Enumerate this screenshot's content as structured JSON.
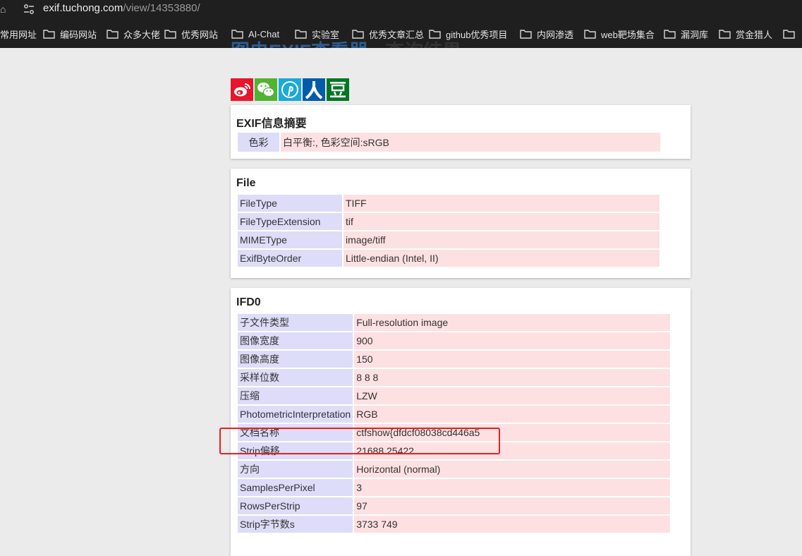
{
  "browser": {
    "url_host": "exif.tuchong.com",
    "url_path": "/view/14353880/",
    "bookmarks": [
      "常用网址",
      "编码网站",
      "众多大佬",
      "优秀网站",
      "AI-Chat",
      "实验室",
      "优秀文章汇总",
      "github优秀项目",
      "内网渗透",
      "web靶场集合",
      "漏洞库",
      "赏金猎人"
    ]
  },
  "page": {
    "title_part1": "图虫EXIF查看器",
    "title_part2": " - 查询结果",
    "share_icons": [
      "weibo-icon",
      "wechat-icon",
      "pinterest-icon",
      "renren-icon",
      "douban-icon"
    ]
  },
  "summary": {
    "heading": "EXIF信息摘要",
    "rows": [
      {
        "k": "色彩",
        "v": "白平衡:, 色彩空间:sRGB"
      }
    ]
  },
  "file": {
    "heading": "File",
    "rows": [
      {
        "k": "FileType",
        "v": "TIFF"
      },
      {
        "k": "FileTypeExtension",
        "v": "tif"
      },
      {
        "k": "MIMEType",
        "v": "image/tiff"
      },
      {
        "k": "ExifByteOrder",
        "v": "Little-endian (Intel, II)"
      }
    ]
  },
  "ifd0": {
    "heading": "IFD0",
    "rows": [
      {
        "k": "子文件类型",
        "v": "Full-resolution image"
      },
      {
        "k": "图像宽度",
        "v": "900"
      },
      {
        "k": "图像高度",
        "v": "150"
      },
      {
        "k": "采样位数",
        "v": "8 8 8"
      },
      {
        "k": "压缩",
        "v": "LZW"
      },
      {
        "k": "PhotometricInterpretation",
        "v": "RGB"
      },
      {
        "k": "文档名称",
        "v": "ctfshow{dfdcf08038cd446a5"
      },
      {
        "k": "Strip偏移",
        "v": "21688 25422"
      },
      {
        "k": "方向",
        "v": "Horizontal (normal)"
      },
      {
        "k": "SamplesPerPixel",
        "v": "3"
      },
      {
        "k": "RowsPerStrip",
        "v": "97"
      },
      {
        "k": "Strip字节数s",
        "v": "3733 749"
      }
    ]
  }
}
